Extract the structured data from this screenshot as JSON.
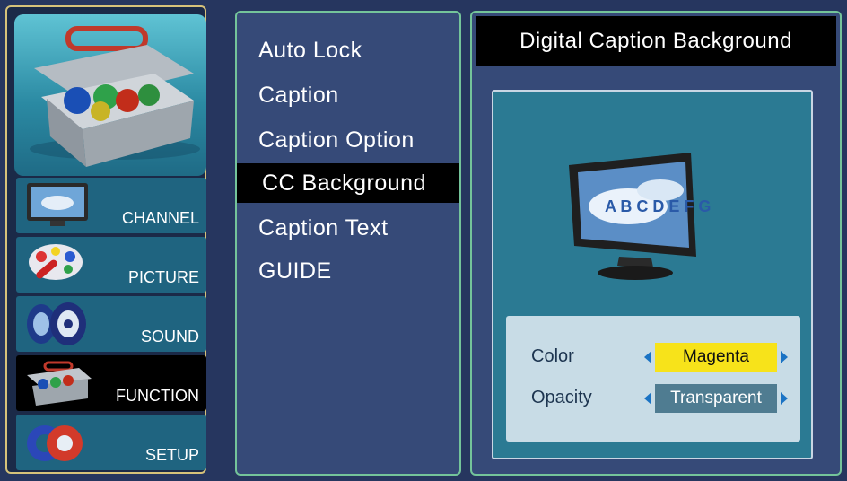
{
  "categories": [
    {
      "label": "CHANNEL",
      "icon": "tv-icon"
    },
    {
      "label": "PICTURE",
      "icon": "palette-icon"
    },
    {
      "label": "SOUND",
      "icon": "speaker-icon"
    },
    {
      "label": "FUNCTION",
      "icon": "toolbox-icon",
      "selected": true
    },
    {
      "label": "SETUP",
      "icon": "gear-icon"
    }
  ],
  "menu": {
    "items": [
      "Auto Lock",
      "Caption",
      "Caption Option",
      "CC Background",
      "Caption Text",
      "GUIDE"
    ],
    "selected": "CC Background"
  },
  "panel": {
    "title": "Digital Caption Background",
    "preview_letters": "A B C D E F G",
    "settings": [
      {
        "label": "Color",
        "value": "Magenta",
        "highlight": "#f7e31a"
      },
      {
        "label": "Opacity",
        "value": "Transparent",
        "highlight": "#4f7c91"
      }
    ]
  },
  "colors": {
    "background": "#26365f",
    "panel": "#364a78",
    "border_green": "#74c49a",
    "border_gold": "#d6c27a",
    "selected": "#000000"
  }
}
